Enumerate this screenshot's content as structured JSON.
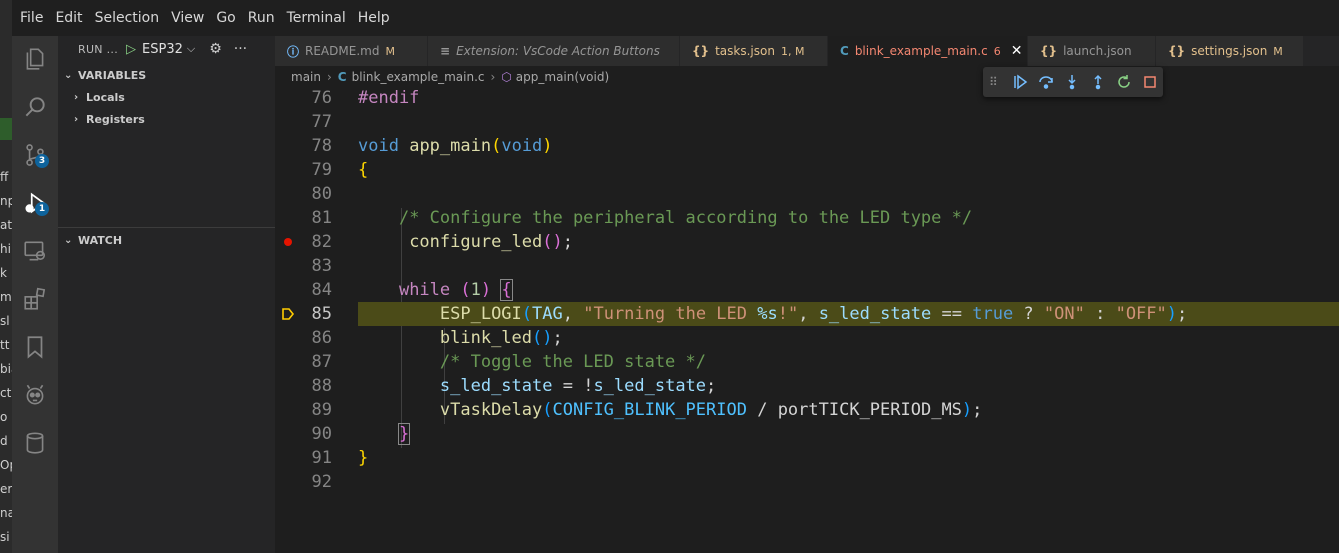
{
  "desktop": {
    "fragments": [
      "ff",
      "np",
      "at",
      "hi",
      "k",
      "m",
      "sl",
      "tt",
      "bia",
      "ct",
      "o",
      "d",
      "Op",
      "er",
      "na",
      "si"
    ]
  },
  "menu": [
    "File",
    "Edit",
    "Selection",
    "View",
    "Go",
    "Run",
    "Terminal",
    "Help"
  ],
  "activity_bar": {
    "items": [
      {
        "name": "explorer-icon"
      },
      {
        "name": "search-icon"
      },
      {
        "name": "source-control-icon",
        "badge": "3"
      },
      {
        "name": "run-debug-icon",
        "badge": "1"
      },
      {
        "name": "remote-explorer-icon"
      },
      {
        "name": "extensions-icon"
      },
      {
        "name": "bookmarks-icon"
      },
      {
        "name": "platformio-icon"
      },
      {
        "name": "database-icon"
      }
    ]
  },
  "sidebar": {
    "run_label": "RUN ...",
    "config": "ESP32",
    "variables_header": "VARIABLES",
    "variables": [
      "Locals",
      "Registers"
    ],
    "watch_header": "WATCH"
  },
  "tabs": [
    {
      "label": "README.md",
      "icon": "info-icon",
      "modified": "M"
    },
    {
      "label": "Extension: VsCode Action Buttons",
      "icon": "extension-icon",
      "modified": ""
    },
    {
      "label": "tasks.json",
      "icon": "json-icon",
      "modified": "1, M"
    },
    {
      "label": "blink_example_main.c",
      "icon": "c-icon",
      "modified": "6",
      "active": true
    },
    {
      "label": "launch.json",
      "icon": "json-icon",
      "modified": ""
    },
    {
      "label": "settings.json",
      "icon": "json-icon",
      "modified": "M"
    }
  ],
  "breadcrumbs": {
    "folder": "main",
    "file": "blink_example_main.c",
    "symbol": "app_main(void)"
  },
  "debug_toolbar": [
    "continue-icon",
    "step-over-icon",
    "step-into-icon",
    "step-out-icon",
    "restart-icon",
    "stop-icon"
  ],
  "editor": {
    "line_numbers": [
      "76",
      "77",
      "78",
      "79",
      "80",
      "81",
      "82",
      "83",
      "84",
      "85",
      "86",
      "87",
      "88",
      "89",
      "90",
      "91",
      "92"
    ],
    "breakpoint_line": "82",
    "current_line": "85",
    "colors": {
      "current_line_bg": "#4b4b18",
      "breakpoint": "#e51400",
      "pointer": "#ffcc00"
    }
  }
}
